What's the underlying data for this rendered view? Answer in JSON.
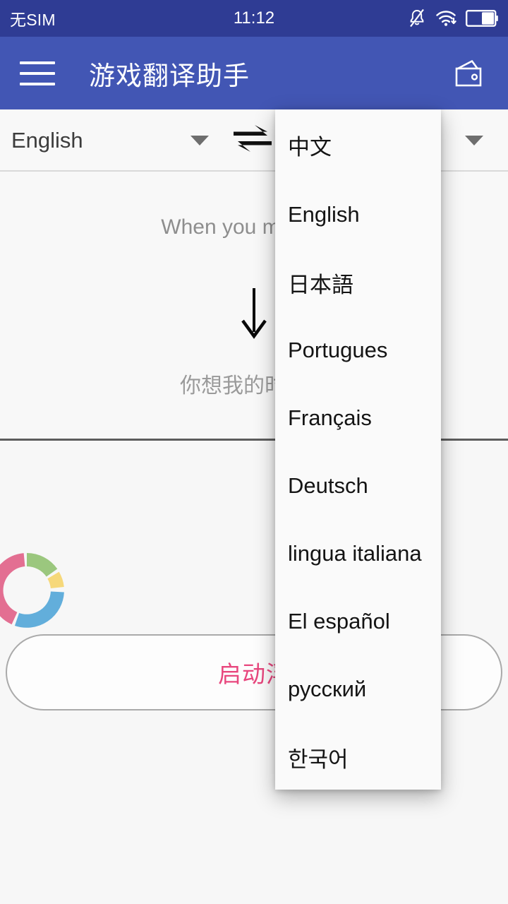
{
  "statusbar": {
    "carrier": "无SIM",
    "clock": "11:12",
    "icons": [
      "bell-muted-icon",
      "wifi-download-icon",
      "battery-half-icon"
    ],
    "background": "#2f3c94",
    "battery_level": 50
  },
  "appbar": {
    "menu_icon": "hamburger-menu-icon",
    "title": "游戏翻译助手",
    "action_icon": "wallet-icon",
    "background": "#4256b4"
  },
  "language_bar": {
    "source_language": "English",
    "source_caret": "chevron-down-icon",
    "swap_icon": "swap-arrows-icon",
    "target_caret": "chevron-down-icon",
    "target_language": ""
  },
  "translation": {
    "source_text": "When you miss me,",
    "arrow_icon": "arrow-down-icon",
    "target_text": "你想我的时候，"
  },
  "lower": {
    "ring_icon": "color-ring-icon",
    "ring_colors": [
      "#e36f92",
      "#9bc77e",
      "#f6d87a",
      "#62aedb"
    ],
    "float_button_label": "启动浮",
    "float_button_color": "#e8477e"
  },
  "dropdown": {
    "visible": true,
    "items": [
      {
        "label": "中文"
      },
      {
        "label": "English"
      },
      {
        "label": "日本語"
      },
      {
        "label": "Portugues"
      },
      {
        "label": "Français"
      },
      {
        "label": "Deutsch"
      },
      {
        "label": "lingua italiana"
      },
      {
        "label": "El español"
      },
      {
        "label": "русский"
      },
      {
        "label": "한국어"
      }
    ]
  }
}
